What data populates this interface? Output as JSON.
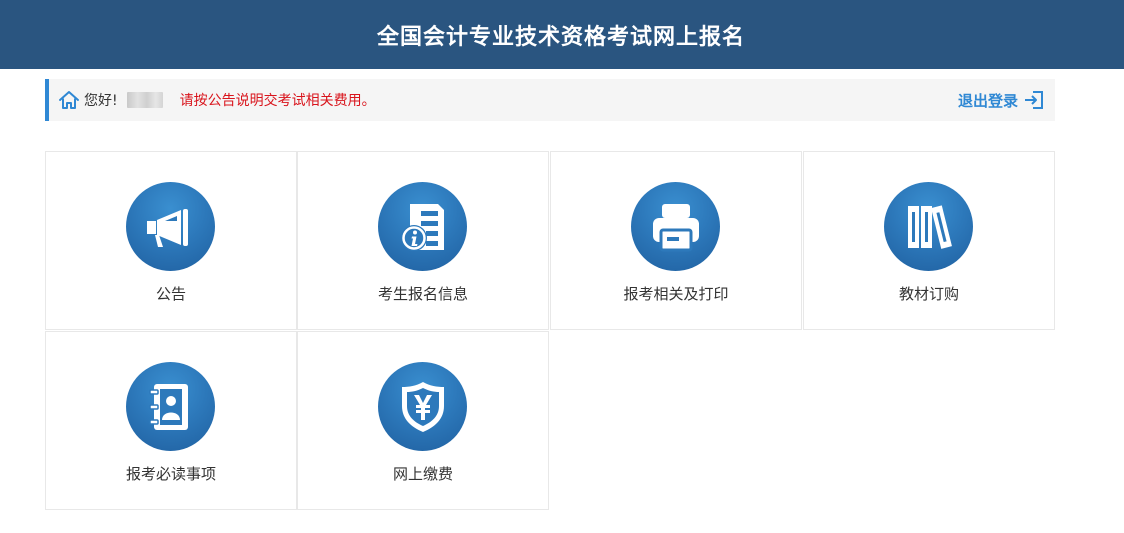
{
  "header": {
    "title": "全国会计专业技术资格考试网上报名"
  },
  "welcome": {
    "greeting": "您好!",
    "notice": "请按公告说明交考试相关费用。",
    "logout_label": "退出登录"
  },
  "tiles": [
    {
      "label": "公告",
      "icon": "megaphone-icon"
    },
    {
      "label": "考生报名信息",
      "icon": "info-document-icon"
    },
    {
      "label": "报考相关及打印",
      "icon": "printer-icon"
    },
    {
      "label": "教材订购",
      "icon": "books-icon"
    },
    {
      "label": "报考必读事项",
      "icon": "contact-book-icon"
    },
    {
      "label": "网上缴费",
      "icon": "yen-shield-icon"
    }
  ],
  "colors": {
    "header_bg": "#2a5580",
    "accent": "#2f88d4",
    "notice": "#d9141c",
    "icon_circle": "#2d79bb"
  }
}
